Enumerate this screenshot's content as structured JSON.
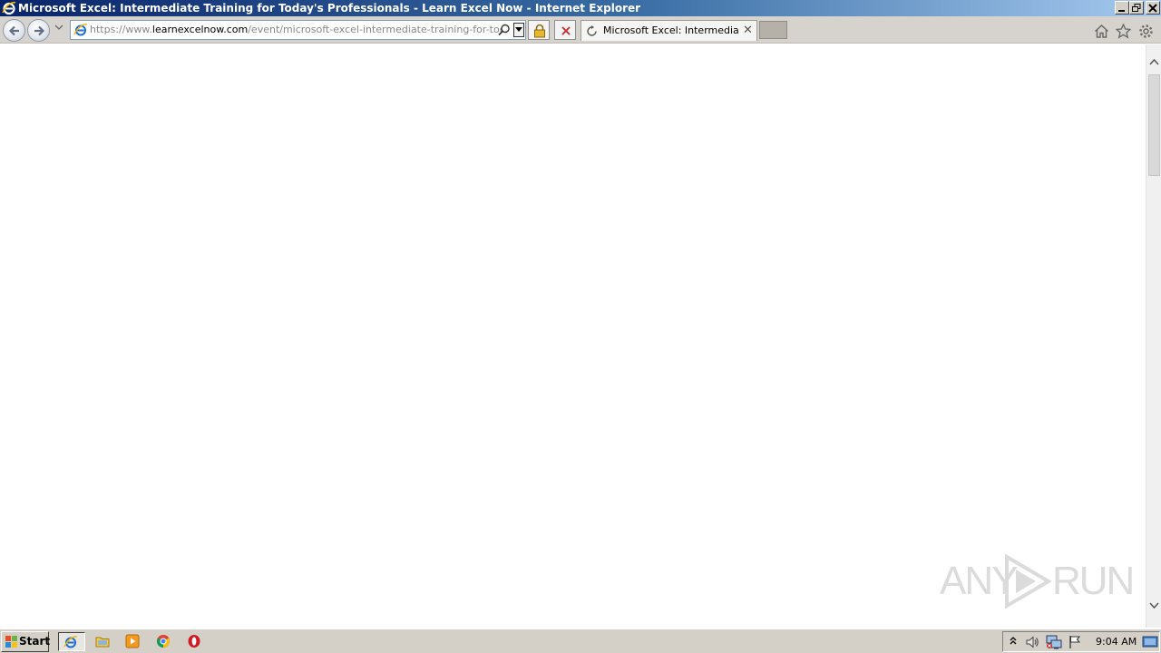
{
  "window": {
    "title": "Microsoft Excel: Intermediate Training for Today's Professionals - Learn Excel Now - Internet Explorer"
  },
  "address_bar": {
    "scheme": "https://www.",
    "domain": "learnexcelnow.com",
    "path": "/event/microsoft-excel-intermediate-training-for-todays-pro"
  },
  "tab": {
    "label": "Microsoft Excel: Intermediat..."
  },
  "watermark": {
    "left": "ANY",
    "right": "RUN"
  },
  "taskbar": {
    "start_label": "Start",
    "clock": "9:04 AM"
  },
  "icons": {
    "back": "back-arrow-icon",
    "forward": "forward-arrow-icon",
    "home": "home-icon",
    "favorites": "star-icon",
    "tools": "gear-icon",
    "lock": "lock-icon",
    "stop": "stop-x-icon"
  },
  "colors": {
    "titlebar_start": "#0a246a",
    "titlebar_end": "#a6caf0",
    "chrome": "#d6d3ce",
    "taskbar": "#d4d0c8"
  }
}
